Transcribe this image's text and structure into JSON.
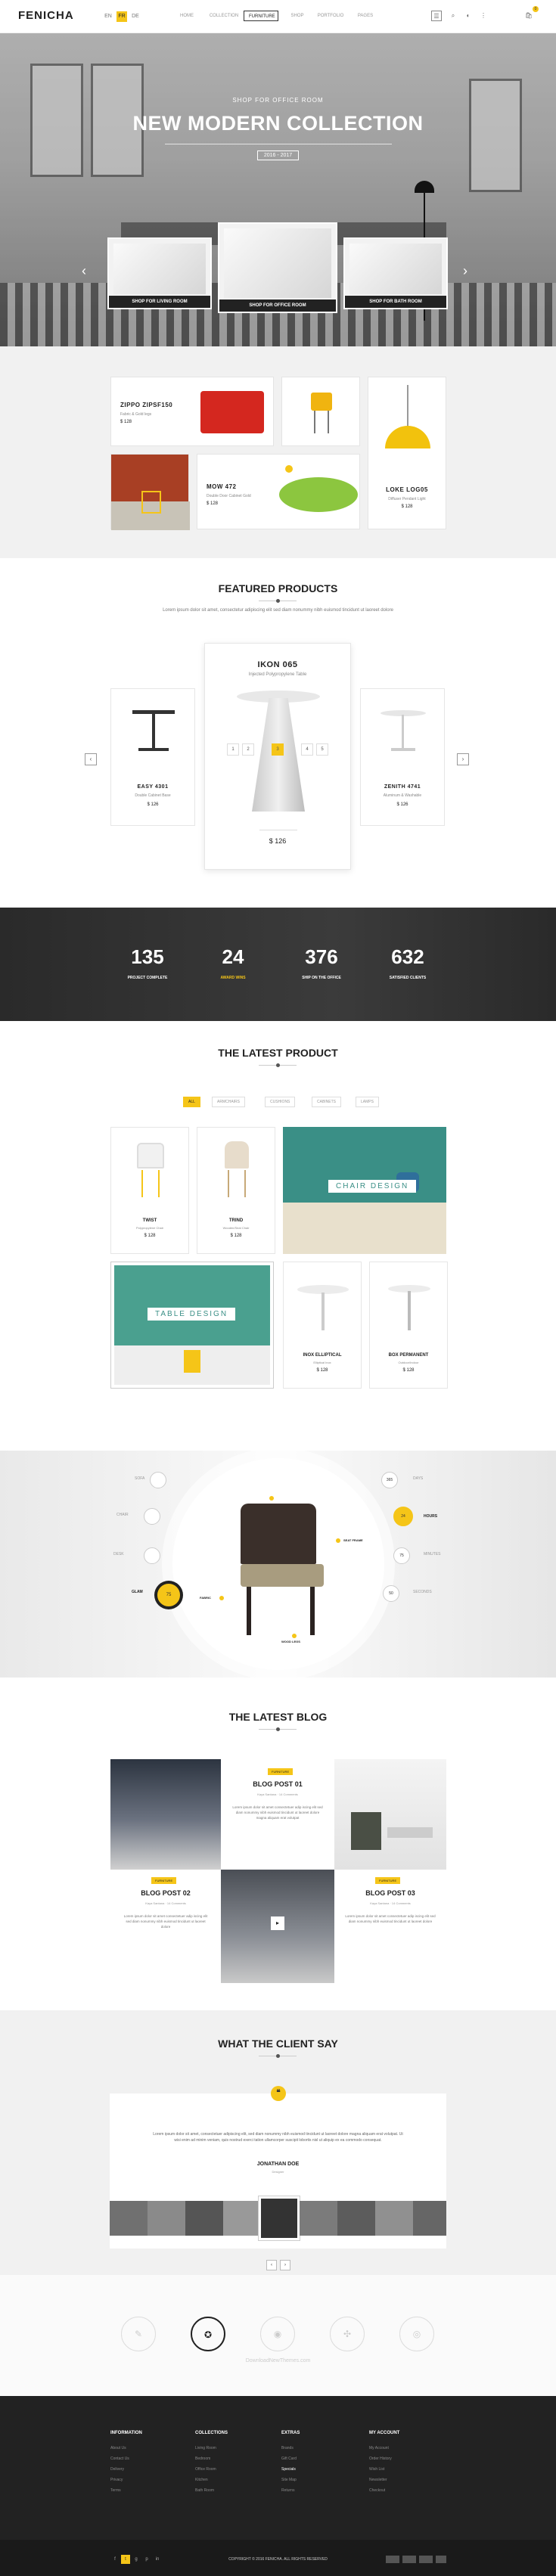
{
  "header": {
    "logo": "FENICHA",
    "langs": [
      "EN",
      "FR",
      "DE"
    ],
    "nav": [
      "HOME",
      "COLLECTION",
      "FURNITURE",
      "SHOP",
      "PORTFOLIO",
      "PAGES"
    ],
    "active_nav": "FURNITURE",
    "search_icon": "search-icon",
    "user_icon": "user-icon",
    "cart_icon": "cart-icon",
    "cart_count": "0"
  },
  "hero": {
    "subtitle": "SHOP FOR OFFICE ROOM",
    "title": "NEW MODERN COLLECTION",
    "date": "2016 - 2017",
    "cards": [
      "SHOP FOR LIVING ROOM",
      "SHOP FOR OFFICE ROOM",
      "SHOP FOR BATH ROOM"
    ]
  },
  "collections": {
    "items": [
      {
        "name": "ZIPPO ZIPSF150",
        "desc": "Fabric & Gold legs",
        "price": "$ 128"
      },
      {
        "name": "MOW 472",
        "desc": "Double Door Cabinet Gold",
        "price": "$ 128"
      },
      {
        "name": "LOKE LOG05",
        "desc": "Diffuser Pendant Light",
        "price": "$ 128"
      }
    ]
  },
  "featured": {
    "title": "FEATURED PRODUCTS",
    "desc": "Lorem ipsum dolor sit amet, consectetur adipiscing elit sed diam nonummy nibh euismod tincidunt ut laoreet dolore",
    "main": {
      "name": "IKON 065",
      "desc": "Injected Polypropylene Table",
      "price": "$ 126"
    },
    "left": {
      "name": "EASY 4301",
      "desc": "Double Cabinet Base",
      "price": "$ 126"
    },
    "right": {
      "name": "ZENITH 4741",
      "desc": "Aluminum & Washable",
      "price": "$ 126"
    },
    "options": [
      "1",
      "2",
      "3",
      "4",
      "5"
    ]
  },
  "counters": [
    {
      "value": "135",
      "label": "PROJECT COMPLETE"
    },
    {
      "value": "24",
      "label": "AWARD WINS"
    },
    {
      "value": "376",
      "label": "SHIP ON THE OFFICE"
    },
    {
      "value": "632",
      "label": "SATISFIED CLIENTS"
    }
  ],
  "latest": {
    "title": "THE LATEST PRODUCT",
    "tabs": [
      "ALL",
      "ARMCHAIRS",
      "CUSHIONS",
      "CABINETS",
      "LAMPS"
    ],
    "products": [
      {
        "name": "TWIST",
        "desc": "Polypropylene Chair",
        "price": "$ 128"
      },
      {
        "name": "TRIND",
        "desc": "Wooden/Seat Chair",
        "price": "$ 128"
      },
      {
        "name": "INOX ELLIPTICAL",
        "desc": "Elliptical Inox",
        "price": "$ 128"
      },
      {
        "name": "BOX PERMANENT",
        "desc": "Outdoor/Indoor",
        "price": "$ 128"
      }
    ],
    "tile_chair": "CHAIR DESIGN",
    "tile_table": "TABLE DESIGN"
  },
  "hotspot": {
    "left_labels": [
      "SOFA",
      "CHAIR",
      "DESK",
      "GLAM"
    ],
    "left_active": "GLAM",
    "left_value": "75",
    "right_values": [
      "365",
      "24",
      "75",
      "50"
    ],
    "right_labels": [
      "DAYS",
      "HOURS",
      "MINUTES",
      "SECONDS"
    ],
    "right_active": "HOURS",
    "pins": [
      "SEAT FRAME",
      "WOOD LEGS",
      "FABRIC"
    ]
  },
  "blog": {
    "title": "THE LATEST BLOG",
    "posts": [
      {
        "tag": "FURNITURE",
        "title": "BLOG POST 01",
        "author": "Kaya Santana",
        "comments": "14 Comments",
        "excerpt": "Lorem ipsum dolor sit amet consectetuer adip iscing elit sed diam nonummy nibh euismod tincidunt ut laoreet dolore magna aliquam erat volutpat"
      },
      {
        "tag": "FURNITURE",
        "title": "BLOG POST 02",
        "author": "Kaya Santana",
        "comments": "14 Comments",
        "excerpt": "Lorem ipsum dolor sit amet consectetuer adip iscing elit sed diam nonummy nibh euismod tincidunt ut laoreet dolore"
      },
      {
        "tag": "FURNITURE",
        "title": "BLOG POST 03",
        "author": "Kaya Santana",
        "comments": "14 Comments",
        "excerpt": "Lorem ipsum dolor sit amet consectetuer adip iscing elit sed diam nonummy nibh euismod tincidunt ut laoreet dolore"
      }
    ]
  },
  "testimonial": {
    "title": "WHAT THE CLIENT SAY",
    "quote_icon": "quote-icon",
    "text": "Lorem ipsum dolor sit amet, consectetuer adipiscing elit, sed diam nonummy nibh euismod tincidunt ut laoreet dolore magna aliquam erat volutpat. Ut wisi enim ad minim veniam, quis nostrud exerci tation ullamcorper suscipit lobortis nisl ut aliquip ex ea commodo consequat.",
    "name": "JONATHAN DOE",
    "role": "Designer",
    "pages": [
      "‹",
      "›"
    ]
  },
  "social": {
    "icons": [
      "pen-icon",
      "badge-icon",
      "camera-icon",
      "share-icon",
      "target-icon"
    ],
    "watermark": "DownloadNewThemes.com"
  },
  "footer": {
    "columns": [
      {
        "title": "INFORMATION",
        "links": [
          "About Us",
          "Contact Us",
          "Delivery",
          "Privacy",
          "Terms"
        ]
      },
      {
        "title": "COLLECTIONS",
        "links": [
          "Living Room",
          "Bedroom",
          "Office Room",
          "Kitchen",
          "Bath Room"
        ]
      },
      {
        "title": "EXTRAS",
        "links": [
          "Brands",
          "Gift Card",
          "Specials",
          "Site Map",
          "Returns"
        ]
      },
      {
        "title": "MY ACCOUNT",
        "links": [
          "My Account",
          "Order History",
          "Wish List",
          "Newsletter",
          "Checkout"
        ]
      }
    ],
    "copyright": "COPYRIGHT © 2016 FENICHA. ALL RIGHTS RESERVED",
    "social": [
      "f",
      "t",
      "g",
      "p",
      "in"
    ]
  },
  "colors": {
    "accent": "#f5c518",
    "dark": "#222222",
    "teal": "#3a8f86"
  }
}
